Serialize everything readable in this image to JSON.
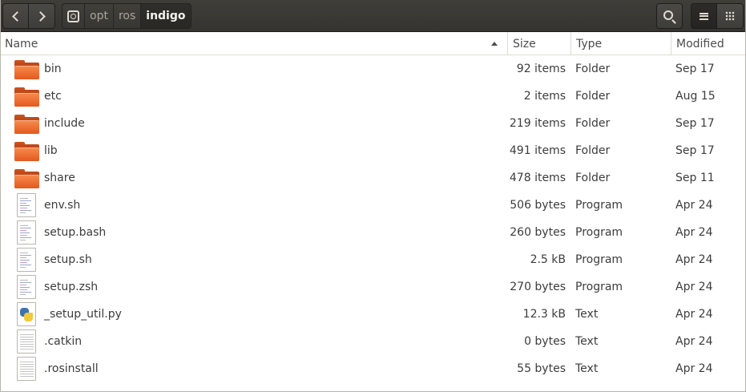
{
  "toolbar": {
    "back_icon": "chevron-left-icon",
    "forward_icon": "chevron-right-icon",
    "search_icon": "search-icon",
    "list_view_icon": "list-view-icon",
    "grid_view_icon": "grid-view-icon"
  },
  "pathbar": {
    "root_icon": "drive-icon",
    "crumbs": [
      "opt",
      "ros",
      "indigo"
    ],
    "current": "indigo"
  },
  "columns": {
    "name": "Name",
    "size": "Size",
    "type": "Type",
    "modified": "Modified",
    "sort": "ascending"
  },
  "files": [
    {
      "name": "bin",
      "size": "92 items",
      "type": "Folder",
      "modified": "Sep 17",
      "icon": "folder-icon"
    },
    {
      "name": "etc",
      "size": "2 items",
      "type": "Folder",
      "modified": "Aug 15",
      "icon": "folder-icon"
    },
    {
      "name": "include",
      "size": "219 items",
      "type": "Folder",
      "modified": "Sep 17",
      "icon": "folder-icon"
    },
    {
      "name": "lib",
      "size": "491 items",
      "type": "Folder",
      "modified": "Sep 17",
      "icon": "folder-icon"
    },
    {
      "name": "share",
      "size": "478 items",
      "type": "Folder",
      "modified": "Sep 11",
      "icon": "folder-icon"
    },
    {
      "name": "env.sh",
      "size": "506 bytes",
      "type": "Program",
      "modified": "Apr 24",
      "icon": "script-file-icon"
    },
    {
      "name": "setup.bash",
      "size": "260 bytes",
      "type": "Program",
      "modified": "Apr 24",
      "icon": "script-file-icon"
    },
    {
      "name": "setup.sh",
      "size": "2.5 kB",
      "type": "Program",
      "modified": "Apr 24",
      "icon": "script-file-icon"
    },
    {
      "name": "setup.zsh",
      "size": "270 bytes",
      "type": "Program",
      "modified": "Apr 24",
      "icon": "script-file-icon"
    },
    {
      "name": "_setup_util.py",
      "size": "12.3 kB",
      "type": "Text",
      "modified": "Apr 24",
      "icon": "python-file-icon"
    },
    {
      "name": ".catkin",
      "size": "0 bytes",
      "type": "Text",
      "modified": "Apr 24",
      "icon": "text-file-icon"
    },
    {
      "name": ".rosinstall",
      "size": "55 bytes",
      "type": "Text",
      "modified": "Apr 24",
      "icon": "text-file-icon"
    }
  ]
}
